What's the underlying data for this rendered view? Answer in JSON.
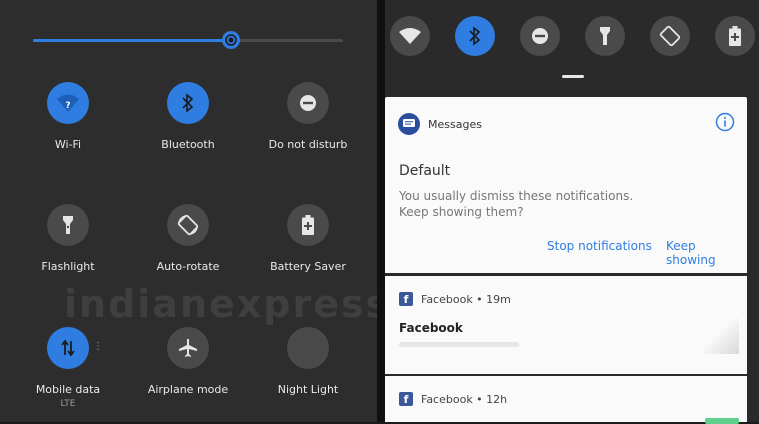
{
  "quick_settings": {
    "brightness_level": 0.64,
    "tiles": [
      {
        "label": "Wi-Fi",
        "icon": "wifi-icon",
        "on": true
      },
      {
        "label": "Bluetooth",
        "icon": "bluetooth-icon",
        "on": true
      },
      {
        "label": "Do not disturb",
        "icon": "do-not-disturb-icon",
        "on": false
      },
      {
        "label": "Flashlight",
        "icon": "flashlight-icon",
        "on": false
      },
      {
        "label": "Auto-rotate",
        "icon": "auto-rotate-icon",
        "on": false
      },
      {
        "label": "Battery Saver",
        "icon": "battery-saver-icon",
        "on": false
      },
      {
        "label": "Mobile data",
        "sub": "LTE",
        "icon": "mobile-data-icon",
        "on": true
      },
      {
        "label": "Airplane mode",
        "icon": "airplane-icon",
        "on": false
      },
      {
        "label": "Night Light",
        "icon": "night-light-icon",
        "on": false
      }
    ]
  },
  "watermark": "indianexpress.com",
  "top_row_icons": [
    "wifi-icon",
    "bluetooth-icon",
    "do-not-disturb-icon",
    "flashlight-icon",
    "auto-rotate-icon",
    "battery-saver-icon"
  ],
  "messages_card": {
    "app_name": "Messages",
    "channel_title": "Default",
    "description_line1": "You usually dismiss these notifications.",
    "description_line2": "Keep showing them?",
    "action_stop": "Stop notifications",
    "action_keep": "Keep showing"
  },
  "facebook_notification_1": {
    "header": "Facebook • 19m",
    "title": "Facebook"
  },
  "facebook_notification_2": {
    "header": "Facebook • 12h"
  },
  "colors": {
    "accent": "#2f7de1",
    "panel": "#2d2d2d",
    "tile_off": "#4a4a4a",
    "facebook": "#3b5998"
  }
}
